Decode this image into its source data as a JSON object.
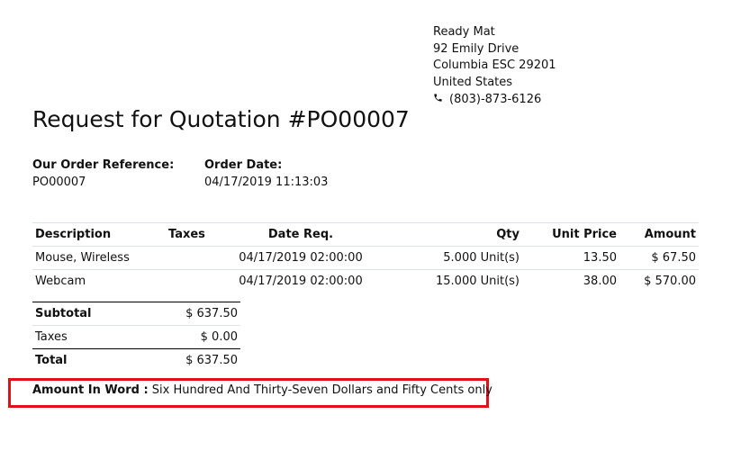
{
  "company": {
    "name": "Ready Mat",
    "street": "92 Emily Drive",
    "city_line": "Columbia ESC 29201",
    "country": "United States",
    "phone": "(803)-873-6126",
    "phone_icon": "phone-icon"
  },
  "title": "Request for Quotation #PO00007",
  "order_reference": {
    "label": "Our Order Reference:",
    "value": "PO00007"
  },
  "order_date": {
    "label": "Order Date:",
    "value": "04/17/2019 11:13:03"
  },
  "lines": {
    "headers": {
      "description": "Description",
      "taxes": "Taxes",
      "date_req": "Date Req.",
      "qty": "Qty",
      "unit_price": "Unit Price",
      "amount": "Amount"
    },
    "rows": [
      {
        "description": "Mouse, Wireless",
        "taxes": "",
        "date_req": "04/17/2019 02:00:00",
        "qty": "5.000 Unit(s)",
        "unit_price": "13.50",
        "amount": "$ 67.50"
      },
      {
        "description": "Webcam",
        "taxes": "",
        "date_req": "04/17/2019 02:00:00",
        "qty": "15.000 Unit(s)",
        "unit_price": "38.00",
        "amount": "$ 570.00"
      }
    ]
  },
  "totals": {
    "subtotal_label": "Subtotal",
    "subtotal_value": "$ 637.50",
    "taxes_label": "Taxes",
    "taxes_value": "$ 0.00",
    "total_label": "Total",
    "total_value": "$ 637.50"
  },
  "amount_in_word": {
    "label": "Amount In Word :",
    "value": "Six Hundred And Thirty-Seven Dollars and Fifty Cents only",
    "highlight_color": "#e0111b"
  }
}
